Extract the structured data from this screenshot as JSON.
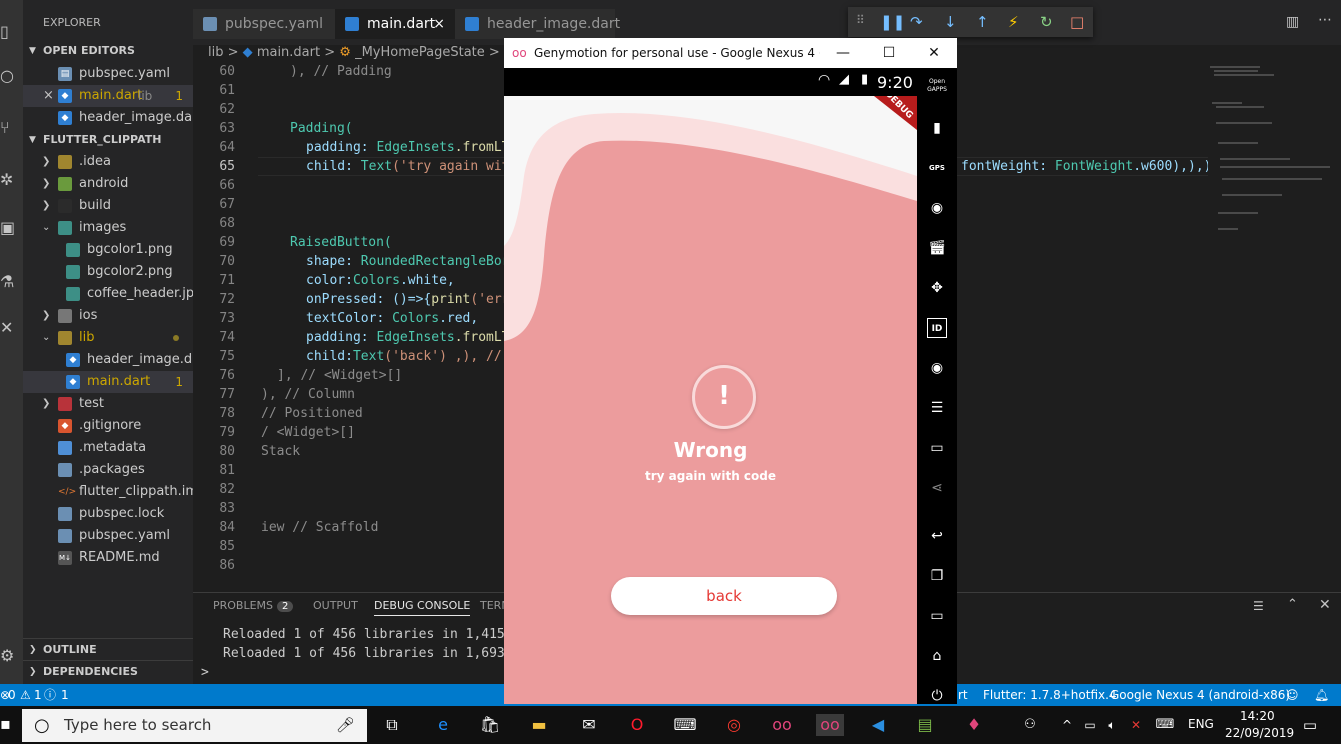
{
  "sidebar": {
    "title": "EXPLORER",
    "open_editors_label": "OPEN EDITORS",
    "open_editors": [
      {
        "name": "pubspec.yaml",
        "extra": "",
        "badge": ""
      },
      {
        "name": "main.dart",
        "extra": "lib",
        "badge": "1"
      },
      {
        "name": "header_image.dar...",
        "extra": "",
        "badge": ""
      }
    ],
    "project_label": "FLUTTER_CLIPPATH",
    "tree": [
      {
        "name": ".idea"
      },
      {
        "name": "android"
      },
      {
        "name": "build"
      },
      {
        "name": "images"
      },
      {
        "name": "bgcolor1.png"
      },
      {
        "name": "bgcolor2.png"
      },
      {
        "name": "coffee_header.jp..."
      },
      {
        "name": "ios"
      },
      {
        "name": "lib"
      },
      {
        "name": "header_image.d..."
      },
      {
        "name": "main.dart",
        "badge": "1"
      },
      {
        "name": "test"
      },
      {
        "name": ".gitignore"
      },
      {
        "name": ".metadata"
      },
      {
        "name": ".packages"
      },
      {
        "name": "flutter_clippath.iml"
      },
      {
        "name": "pubspec.lock"
      },
      {
        "name": "pubspec.yaml"
      },
      {
        "name": "README.md"
      }
    ],
    "outline_label": "OUTLINE",
    "dependencies_label": "DEPENDENCIES"
  },
  "tabs": [
    {
      "label": "pubspec.yaml"
    },
    {
      "label": "main.dart",
      "close": "×"
    },
    {
      "label": "header_image.dart"
    }
  ],
  "breadcrumb": {
    "a": "lib",
    "sep": ">",
    "b": "main.dart",
    "c": "_MyHomePageState"
  },
  "editor": {
    "line_numbers": [
      "60",
      "61",
      "62",
      "63",
      "64",
      "65",
      "66",
      "67",
      "68",
      "69",
      "70",
      "71",
      "72",
      "73",
      "74",
      "75",
      "76",
      "77",
      "78",
      "79",
      "80",
      "81",
      "82",
      "83",
      "84",
      "85",
      "86"
    ],
    "lines": {
      "l60": "), // Padding",
      "l63a": "Padding(",
      "l64a": "padding: ",
      "l64b": "EdgeInsets",
      "l64c": ".fromLT",
      "l65a": "child: ",
      "l65b": "Text",
      "l65c": "('try again wit",
      "l65d": "fontWeight: ",
      "l65e": "FontWeight",
      "l65f": ".w600),),)",
      "l69a": "RaisedButton(",
      "l70a": "shape: ",
      "l70b": "RoundedRectangleBor",
      "l71a": "color:",
      "l71b": "Colors",
      "l71c": ".white,",
      "l72a": "onPressed: ()=>{",
      "l72b": "print",
      "l72c": "('err",
      "l73a": "textColor: ",
      "l73b": "Colors",
      "l73c": ".red,",
      "l74a": "padding: ",
      "l74b": "EdgeInsets",
      "l74c": ".fromLT",
      "l75a": "child:",
      "l75b": "Text",
      "l75c": "('back') ,), //",
      "l76": "], // <Widget>[]",
      "l77": "), // Column",
      "l78": "// Positioned",
      "l79": "/ <Widget>[]",
      "l80": "Stack",
      "l84": "iew // Scaffold"
    }
  },
  "panel": {
    "tabs": {
      "problems": "PROBLEMS",
      "problems_count": "2",
      "output": "OUTPUT",
      "debug": "DEBUG CONSOLE",
      "terminal": "TERM"
    },
    "lines": [
      "Reloaded 1 of 456 libraries in 1,415r",
      "Reloaded 1 of 456 libraries in 1,693r"
    ],
    "prompt": ">"
  },
  "status": {
    "errors": "0",
    "warnings": "1",
    "infos": "1",
    "rt": "rt",
    "flutter": "Flutter: 1.7.8+hotfix.4",
    "device": "Google Nexus 4 (android-x86)"
  },
  "emulator": {
    "window_title": "Genymotion for personal use - Google Nexus 4 (768x...",
    "clock": "9:20",
    "debug_banner": "DEBUG",
    "alert_icon": "!",
    "heading": "Wrong",
    "subtitle": "try again with code",
    "button": "back",
    "side_top_label": "Open GAPPS",
    "side_gps": "GPS",
    "side_id": "ID",
    "colors": {
      "background": "#ec9c9d",
      "button_text": "#e53935"
    }
  },
  "taskbar": {
    "search_placeholder": "Type here to search",
    "lang": "ENG",
    "time": "14:20",
    "date": "22/09/2019"
  }
}
